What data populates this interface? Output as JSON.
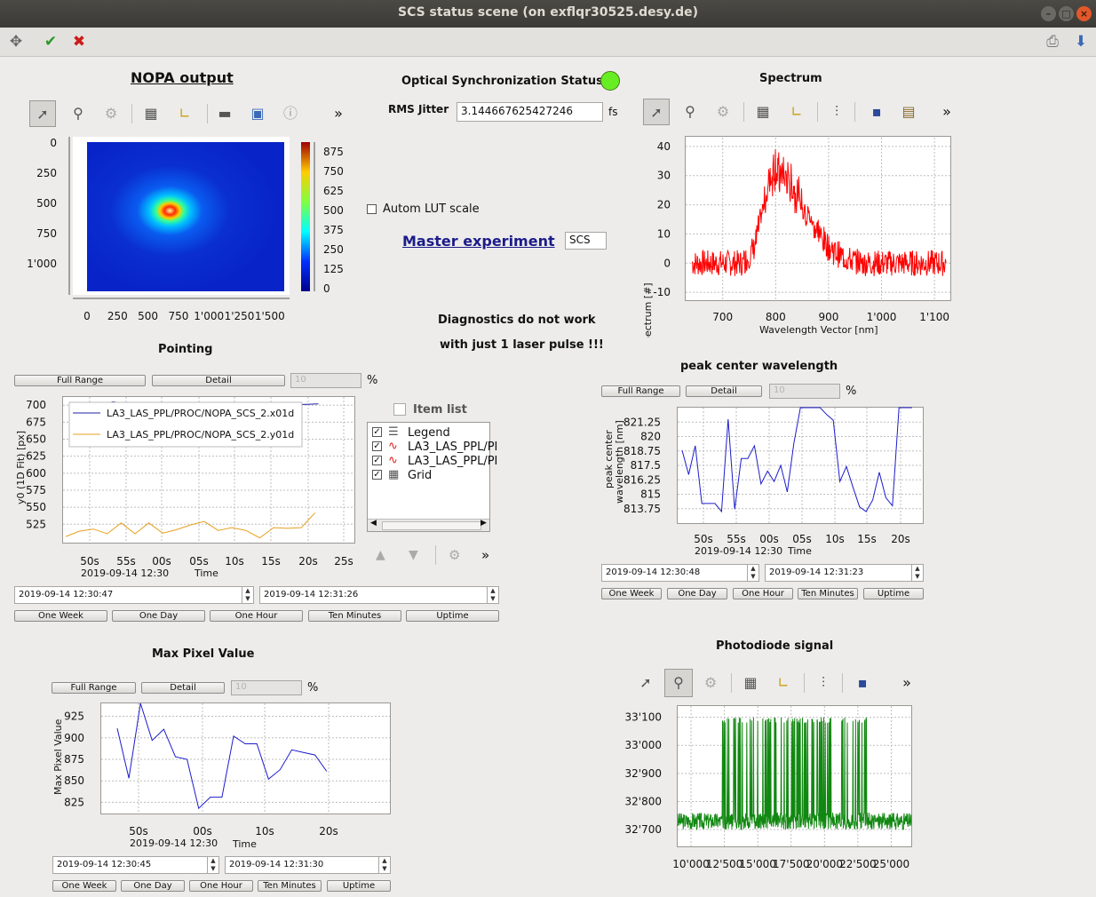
{
  "window": {
    "title": "SCS status scene (on exflqr30525.desy.de)"
  },
  "toolbar": {
    "move": "✥",
    "confirm": "✔",
    "cancel": "✖",
    "print": "⎙",
    "download": "⬇"
  },
  "nopa": {
    "title": "NOPA output",
    "yticks": [
      "0",
      "250",
      "500",
      "750",
      "1'000"
    ],
    "xticks": [
      "0",
      "250",
      "500",
      "750",
      "1'000",
      "1'250",
      "1'500"
    ],
    "cbar_ticks": [
      "875",
      "750",
      "625",
      "500",
      "375",
      "250",
      "125",
      "0"
    ]
  },
  "sync": {
    "title": "Optical Synchronization Status",
    "status_color": "#66ee22",
    "jitter_label": "RMS Jitter",
    "jitter_value": "3.144667625427246",
    "jitter_unit": "fs"
  },
  "lut": {
    "label": "Autom LUT scale",
    "checked": false
  },
  "master": {
    "label": "Master experiment",
    "value": "SCS"
  },
  "diag": {
    "line1": "Diagnostics do not work",
    "line2": "with just 1 laser pulse !!!"
  },
  "spectrum": {
    "title": "Spectrum",
    "ylabel": "Spectrum [#]",
    "xlabel": "Wavelength Vector [nm]",
    "yticks": [
      "40",
      "30",
      "20",
      "10",
      "0",
      "-10"
    ],
    "xticks": [
      "700",
      "800",
      "900",
      "1'000",
      "1'100"
    ]
  },
  "pointing": {
    "title": "Pointing",
    "full_range": "Full Range",
    "detail": "Detail",
    "pct_value": "10",
    "pct_unit": "%",
    "ylabel": "y0 (1D Fit) [px]",
    "yticks": [
      "700",
      "675",
      "650",
      "625",
      "600",
      "575",
      "550",
      "525"
    ],
    "xticks": [
      "50s",
      "55s",
      "00s",
      "05s",
      "10s",
      "15s",
      "20s",
      "25s"
    ],
    "date": "2019-09-14 12:30",
    "xlabel": "Time",
    "legend": [
      "LA3_LAS_PPL/PROC/NOPA_SCS_2.x01d",
      "LA3_LAS_PPL/PROC/NOPA_SCS_2.y01d"
    ],
    "start": "2019-09-14 12:30:47",
    "end": "2019-09-14 12:31:26",
    "ranges": [
      "One Week",
      "One Day",
      "One Hour",
      "Ten Minutes",
      "Uptime"
    ]
  },
  "itemlist": {
    "title": "Item list",
    "items": [
      "Legend",
      "LA3_LAS_PPL/PI",
      "LA3_LAS_PPL/PI",
      "Grid"
    ]
  },
  "peak": {
    "title": "peak center wavelength",
    "full_range": "Full Range",
    "detail": "Detail",
    "pct_value": "10",
    "pct_unit": "%",
    "ylabel1": "peak center",
    "ylabel2": "wavelength [nm]",
    "yticks": [
      "821.25",
      "820",
      "818.75",
      "817.5",
      "816.25",
      "815",
      "813.75"
    ],
    "xticks": [
      "50s",
      "55s",
      "00s",
      "05s",
      "10s",
      "15s",
      "20s"
    ],
    "date": "2019-09-14 12:30",
    "xlabel": "Time",
    "start": "2019-09-14 12:30:48",
    "end": "2019-09-14 12:31:23",
    "ranges": [
      "One Week",
      "One Day",
      "One Hour",
      "Ten Minutes",
      "Uptime"
    ]
  },
  "maxpix": {
    "title": "Max Pixel Value",
    "full_range": "Full Range",
    "detail": "Detail",
    "pct_value": "10",
    "pct_unit": "%",
    "ylabel": "Max Pixel Value",
    "yticks": [
      "925",
      "900",
      "875",
      "850",
      "825"
    ],
    "xticks": [
      "50s",
      "00s",
      "10s",
      "20s"
    ],
    "date": "2019-09-14 12:30",
    "xlabel": "Time",
    "start": "2019-09-14 12:30:45",
    "end": "2019-09-14 12:31:30",
    "ranges": [
      "One Week",
      "One Day",
      "One Hour",
      "Ten Minutes",
      "Uptime"
    ]
  },
  "photodiode": {
    "title": "Photodiode signal",
    "yticks": [
      "33'100",
      "33'000",
      "32'900",
      "32'800",
      "32'700"
    ],
    "xticks": [
      "10'000",
      "12'500",
      "15'000",
      "17'500",
      "20'000",
      "22'500",
      "25'000"
    ]
  },
  "chart_data": [
    {
      "type": "line",
      "name": "spectrum",
      "x_range": [
        630,
        1130
      ],
      "ylim": [
        -13,
        43
      ],
      "color": "#ff0000",
      "peak": {
        "x": 800,
        "y": 40
      },
      "baseline": 0
    },
    {
      "type": "line",
      "name": "peak",
      "ylim": [
        812.5,
        822.5
      ],
      "color": "#1c1ccc",
      "x": [
        0,
        1,
        2,
        3,
        4,
        5,
        6,
        7,
        8,
        9,
        10,
        11,
        12,
        13,
        14,
        15,
        16,
        17,
        18,
        19,
        20,
        21,
        22,
        23,
        24,
        25,
        26,
        27,
        28,
        29,
        30,
        31,
        32,
        33,
        34,
        35
      ],
      "values": [
        818.8,
        816.7,
        819.2,
        814.2,
        814.2,
        814.2,
        813.5,
        821.5,
        813.7,
        818.1,
        818.1,
        819.2,
        815.9,
        817.0,
        816.1,
        817.5,
        815.2,
        819.4,
        823,
        823,
        823,
        823,
        821.9,
        821.4,
        816.1,
        817.4,
        815.6,
        813.9,
        813.5,
        814.5,
        816.9,
        814.7,
        814.0,
        823,
        823,
        823
      ]
    },
    {
      "type": "line",
      "name": "maxpix",
      "ylim": [
        812,
        940
      ],
      "color": "#1c1ccc",
      "x": [
        0,
        1,
        2,
        3,
        4,
        5,
        6,
        7,
        8,
        9,
        10,
        11,
        12,
        13,
        14,
        15,
        16,
        17,
        18,
        19,
        20,
        21,
        22
      ],
      "values": [
        911,
        853,
        940,
        897,
        910,
        878,
        875,
        818,
        831,
        831,
        902,
        893,
        893,
        852,
        863,
        886,
        883,
        880,
        861
      ]
    },
    {
      "type": "line",
      "name": "pointing-x",
      "color": "#2222aa",
      "values": [
        700,
        700,
        700,
        705,
        701,
        700,
        700,
        700,
        700,
        700,
        700,
        700,
        700,
        700,
        700,
        700,
        701,
        702
      ]
    },
    {
      "type": "line",
      "name": "pointing-y",
      "color": "#e6a020",
      "values": [
        507,
        515,
        518,
        511,
        527,
        511,
        527,
        512,
        517,
        524,
        529,
        516,
        520,
        516,
        505,
        520,
        519,
        520,
        542
      ]
    },
    {
      "type": "line",
      "name": "photodiode",
      "ylim": [
        32640,
        33140
      ],
      "x_range": [
        9000,
        26500
      ],
      "color": "#118811"
    }
  ]
}
